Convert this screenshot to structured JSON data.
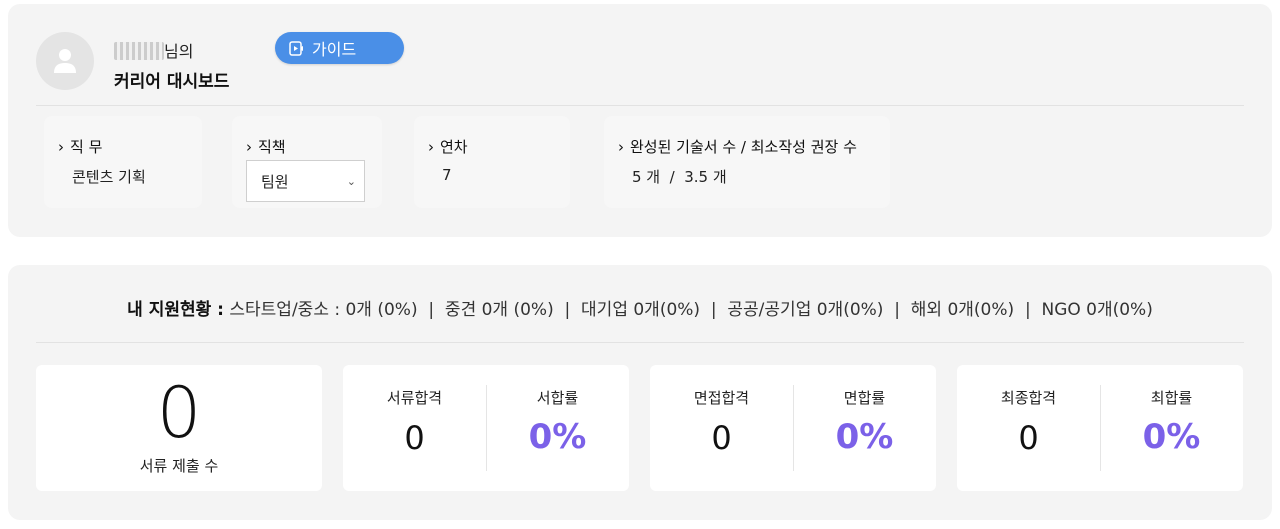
{
  "profile": {
    "name_suffix": "님의",
    "dashboard_title": "커리어 대시보드",
    "guide_button": "가이드"
  },
  "info": {
    "job": {
      "label": "직 무",
      "value": "콘텐츠 기획"
    },
    "position": {
      "label": "직책",
      "selected": "팀원"
    },
    "years": {
      "label": "연차",
      "value": "7"
    },
    "docs": {
      "label": "완성된 기술서 수 / 최소작성 권장 수",
      "value": "5 개  /  3.5 개"
    }
  },
  "applications": {
    "title": "내 지원현황 :",
    "summary": " 스타트업/중소 : 0개 (0%)  |  중견 0개 (0%)  |  대기업 0개(0%)  |  공공/공기업 0개(0%)  |  해외 0개(0%)  |  NGO 0개(0%)"
  },
  "stats": {
    "submitted": {
      "value": "0",
      "label": "서류 제출 수"
    },
    "doc_pass": {
      "label": "서류합격",
      "value": "0",
      "rate_label": "서합률",
      "rate": "0%"
    },
    "interview_pass": {
      "label": "면접합격",
      "value": "0",
      "rate_label": "면합률",
      "rate": "0%"
    },
    "final_pass": {
      "label": "최종합격",
      "value": "0",
      "rate_label": "최합률",
      "rate": "0%"
    }
  },
  "colors": {
    "accent_button": "#4a8fe7",
    "rate_purple": "#7b61e8",
    "panel_bg": "#f4f4f4"
  },
  "icons": {
    "avatar": "user-icon",
    "guide": "video-icon",
    "chevron": "chevron-right-icon",
    "select_caret": "chevron-down-icon"
  }
}
